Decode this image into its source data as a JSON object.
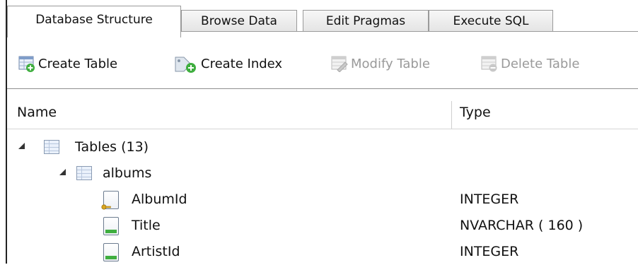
{
  "tabs": [
    {
      "label": "Database Structure",
      "active": true
    },
    {
      "label": "Browse Data",
      "active": false
    },
    {
      "label": "Edit Pragmas",
      "active": false
    },
    {
      "label": "Execute SQL",
      "active": false
    }
  ],
  "toolbar": {
    "create_table": {
      "label": "Create Table",
      "icon": "create-table-icon",
      "enabled": true
    },
    "create_index": {
      "label": "Create Index",
      "icon": "create-index-icon",
      "enabled": true
    },
    "modify_table": {
      "label": "Modify Table",
      "icon": "modify-table-icon",
      "enabled": false
    },
    "delete_table": {
      "label": "Delete Table",
      "icon": "delete-table-icon",
      "enabled": false
    }
  },
  "columns": {
    "name": "Name",
    "type": "Type"
  },
  "tree": {
    "tables_node": {
      "label": "Tables (13)",
      "expanded": true
    },
    "albums_node": {
      "label": "albums",
      "expanded": true
    },
    "fields": [
      {
        "name": "AlbumId",
        "type": "INTEGER",
        "icon": "primary-key-field-icon"
      },
      {
        "name": "Title",
        "type": "NVARCHAR ( 160 )",
        "icon": "field-icon"
      },
      {
        "name": "ArtistId",
        "type": "INTEGER",
        "icon": "field-icon"
      }
    ]
  },
  "colors": {
    "field_bar": "#3fae3f",
    "key": "#d9a520",
    "disabled_text": "#9a9a9a"
  }
}
